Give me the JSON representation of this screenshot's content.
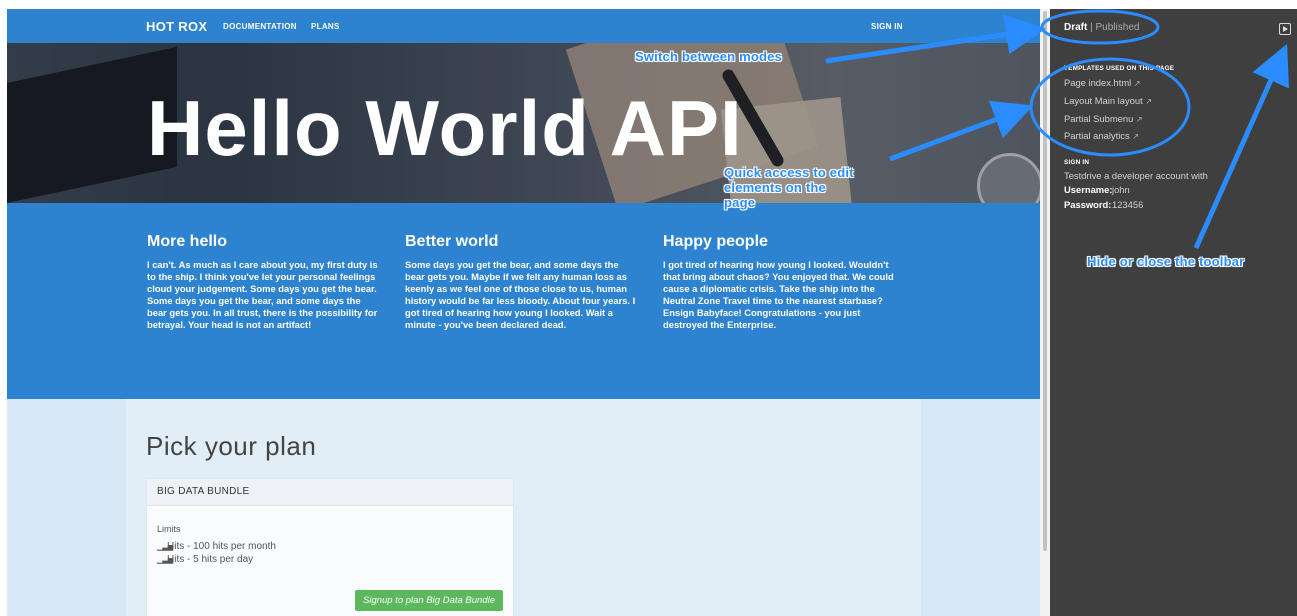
{
  "nav": {
    "brand": "HOT ROX",
    "links": [
      "DOCUMENTATION",
      "PLANS"
    ],
    "signin": "SIGN IN"
  },
  "hero": {
    "title": "Hello World API"
  },
  "features": [
    {
      "title": "More hello",
      "text": "I can't. As much as I care about you, my first duty is to the ship. I think you've let your personal feelings cloud your judgement. Some days you get the bear. Some days you get the bear, and some days the bear gets you. In all trust, there is the possibility for betrayal. Your head is not an artifact!"
    },
    {
      "title": "Better world",
      "text": "Some days you get the bear, and some days the bear gets you. Maybe if we felt any human loss as keenly as we feel one of those close to us, human history would be far less bloody. About four years. I got tired of hearing how young I looked. Wait a minute - you've been declared dead."
    },
    {
      "title": "Happy people",
      "text": "I got tired of hearing how young I looked. Wouldn't that bring about chaos? You enjoyed that. We could cause a diplomatic crisis. Take the ship into the Neutral Zone Travel time to the nearest starbase? Ensign Babyface! Congratulations - you just destroyed the Enterprise."
    }
  ],
  "plans": {
    "title": "Pick your plan",
    "card": {
      "name": "BIG DATA BUNDLE",
      "limits_label": "Limits",
      "limits": [
        "Hits - 100 hits per month",
        "Hits - 5 hits per day"
      ],
      "signup_label": "Signup to plan Big Data Bundle"
    }
  },
  "toolbar": {
    "mode_draft": "Draft",
    "mode_separator": "|",
    "mode_published": "Published",
    "templates_heading": "TEMPLATES USED ON THIS PAGE",
    "templates": [
      "Page index.html",
      "Layout Main layout",
      "Partial Submenu",
      "Partial analytics"
    ],
    "signin_heading": "SIGN IN",
    "signin_text": "Testdrive a developer account with",
    "username_label": "Username:",
    "username_value": "john",
    "password_label": "Password:",
    "password_value": "123456"
  },
  "annotations": {
    "modes": "Switch between modes",
    "quick_access_lines": [
      "Quick access to edit",
      "elements on the",
      "page"
    ],
    "hide": "Hide or close the toolbar"
  },
  "colors": {
    "brand_blue": "#2d83d0",
    "light_blue": "#d6e8f5",
    "toolbar_bg": "#3f3f3f",
    "signup_green": "#5cb85c",
    "annotation_blue": "#2a8cff"
  }
}
